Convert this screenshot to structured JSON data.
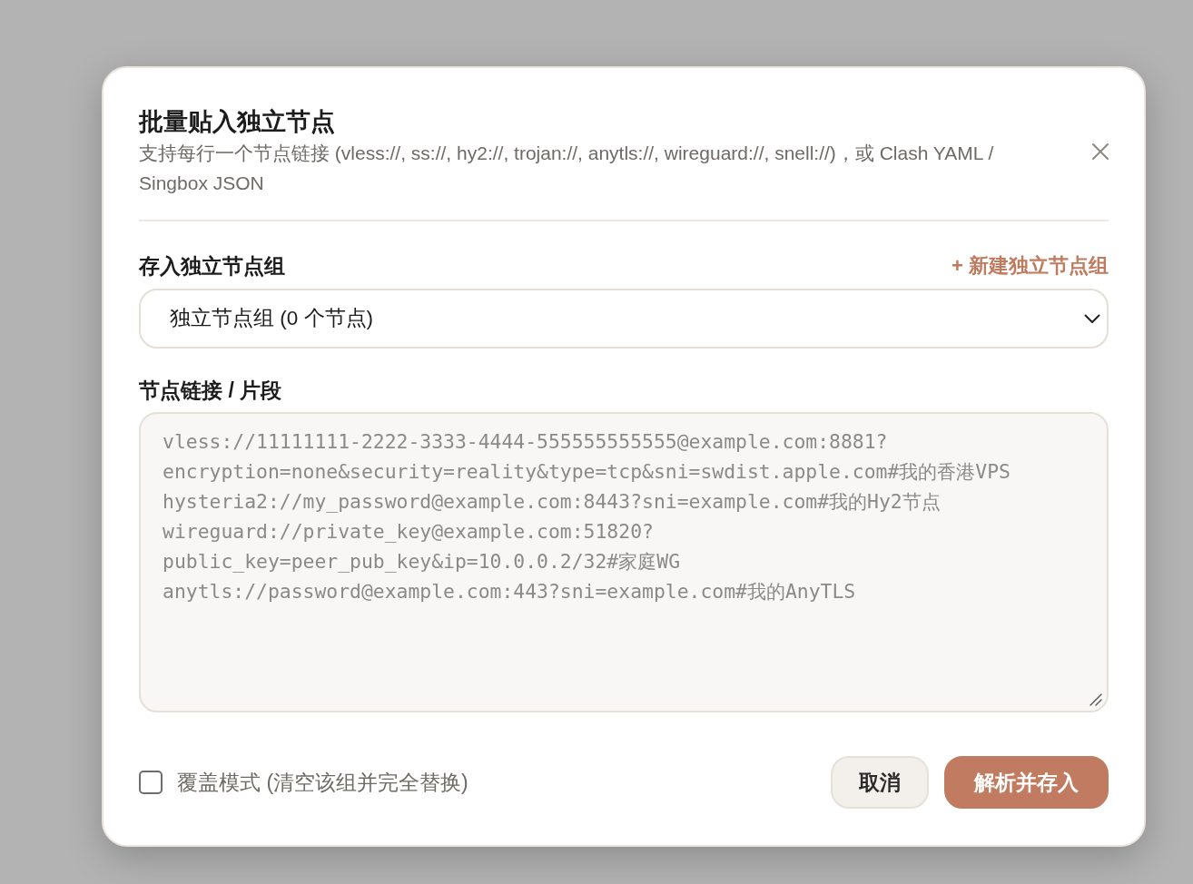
{
  "dialog": {
    "title": "批量贴入独立节点",
    "description": "支持每行一个节点链接 (vless://, ss://, hy2://, trojan://, anytls://, wireguard://, snell://)，或 Clash YAML / Singbox JSON"
  },
  "group_field": {
    "label": "存入独立节点组",
    "action": "+ 新建独立节点组",
    "value": "独立节点组 (0 个节点)"
  },
  "links_field": {
    "label": "节点链接 / 片段",
    "placeholder": "vless://11111111-2222-3333-4444-555555555555@example.com:8881?encryption=none&security=reality&type=tcp&sni=swdist.apple.com#我的香港VPS\nhysteria2://my_password@example.com:8443?sni=example.com#我的Hy2节点\nwireguard://private_key@example.com:51820?public_key=peer_pub_key&ip=10.0.0.2/32#家庭WG\nanytls://password@example.com:443?sni=example.com#我的AnyTLS"
  },
  "overwrite_mode": {
    "label": "覆盖模式 (清空该组并完全替换)",
    "checked": false
  },
  "buttons": [
    {
      "label": "取消",
      "kind": "secondary"
    },
    {
      "label": "解析并存入",
      "kind": "primary"
    }
  ]
}
